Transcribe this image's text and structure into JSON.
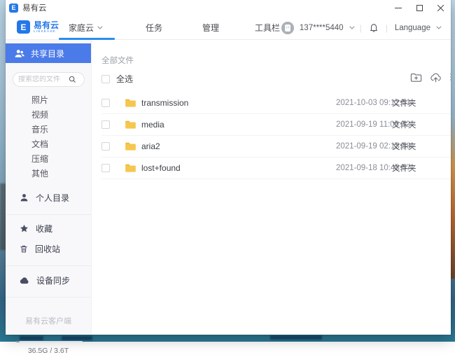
{
  "window": {
    "title": "易有云"
  },
  "navbar": {
    "logo_text": "易有云",
    "logo_subtext": "LINKEASE",
    "tabs": [
      {
        "label": "家庭云",
        "active": true,
        "has_dropdown": true
      },
      {
        "label": "任务",
        "active": false,
        "has_dropdown": false
      },
      {
        "label": "管理",
        "active": false,
        "has_dropdown": false
      },
      {
        "label": "工具栏",
        "active": false,
        "has_dropdown": false
      }
    ],
    "user_name": "137****5440",
    "language_label": "Language"
  },
  "sidebar": {
    "shared_dir_label": "共享目录",
    "search_placeholder": "搜索您的文件",
    "categories": [
      {
        "label": "照片"
      },
      {
        "label": "视频"
      },
      {
        "label": "音乐"
      },
      {
        "label": "文档"
      },
      {
        "label": "压缩"
      },
      {
        "label": "其他"
      }
    ],
    "personal_dir_label": "个人目录",
    "favorites_label": "收藏",
    "recycle_label": "回收站",
    "device_sync_label": "设备同步",
    "client_label": "易有云客户端",
    "storage_usage": "36.5G / 3.6T",
    "storage_percent": 5
  },
  "main": {
    "breadcrumb": "全部文件",
    "select_all_label": "全选",
    "files": [
      {
        "name": "transmission",
        "date": "2021-10-03 09:12:51",
        "type": "文件夹"
      },
      {
        "name": "media",
        "date": "2021-09-19 11:06:32",
        "type": "文件夹"
      },
      {
        "name": "aria2",
        "date": "2021-09-19 02:18:38",
        "type": "文件夹"
      },
      {
        "name": "lost+found",
        "date": "2021-09-18 10:48:57",
        "type": "文件夹"
      }
    ]
  },
  "colors": {
    "accent_blue": "#4b7be8",
    "tab_underline_blue": "#2a8cf0",
    "folder_yellow": "#f5c74e"
  }
}
